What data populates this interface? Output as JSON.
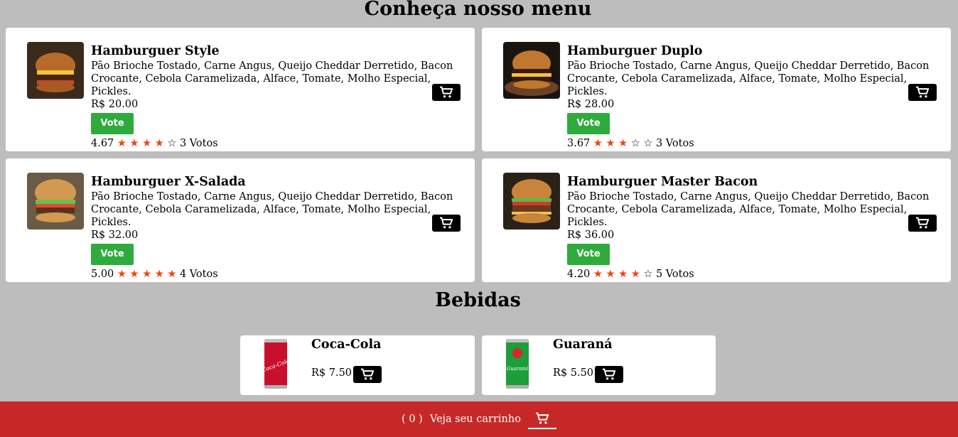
{
  "menu_title": "Conheça nosso menu",
  "drinks_title": "Bebidas",
  "vote_label": "Vote",
  "burgers": [
    {
      "name": "Hamburguer Style",
      "desc": "Pão Brioche Tostado, Carne Angus, Queijo Cheddar Derretido, Bacon Crocante, Cebola Caramelizada, Alface, Tomate, Molho Especial, Pickles.",
      "price": "R$ 20.00",
      "rating": "4.67",
      "stars": 4,
      "votes": "3 Votos"
    },
    {
      "name": "Hamburguer Duplo",
      "desc": "Pão Brioche Tostado, Carne Angus, Queijo Cheddar Derretido, Bacon Crocante, Cebola Caramelizada, Alface, Tomate, Molho Especial, Pickles.",
      "price": "R$ 28.00",
      "rating": "3.67",
      "stars": 3,
      "votes": "3 Votos"
    },
    {
      "name": "Hamburguer X-Salada",
      "desc": "Pão Brioche Tostado, Carne Angus, Queijo Cheddar Derretido, Bacon Crocante, Cebola Caramelizada, Alface, Tomate, Molho Especial, Pickles.",
      "price": "R$ 32.00",
      "rating": "5.00",
      "stars": 5,
      "votes": "4 Votos"
    },
    {
      "name": "Hamburguer Master Bacon",
      "desc": "Pão Brioche Tostado, Carne Angus, Queijo Cheddar Derretido, Bacon Crocante, Cebola Caramelizada, Alface, Tomate, Molho Especial, Pickles.",
      "price": "R$ 36.00",
      "rating": "4.20",
      "stars": 4,
      "votes": "5 Votos"
    }
  ],
  "drinks": [
    {
      "name": "Coca-Cola",
      "price": "R$ 7.50",
      "can_color": "#c8102e",
      "can_text": "Coca-Cola"
    },
    {
      "name": "Guaraná",
      "price": "R$ 5.50",
      "can_color": "#1e9e3a",
      "can_text": "Guaraná"
    }
  ],
  "footer": {
    "count": "( 0 )",
    "label": "Veja seu carrinho"
  },
  "icons": {
    "cart": "shopping-cart-icon",
    "star": "star-icon"
  },
  "colors": {
    "accent": "#c62828",
    "vote": "#2eab3c",
    "star": "#f1420f"
  }
}
